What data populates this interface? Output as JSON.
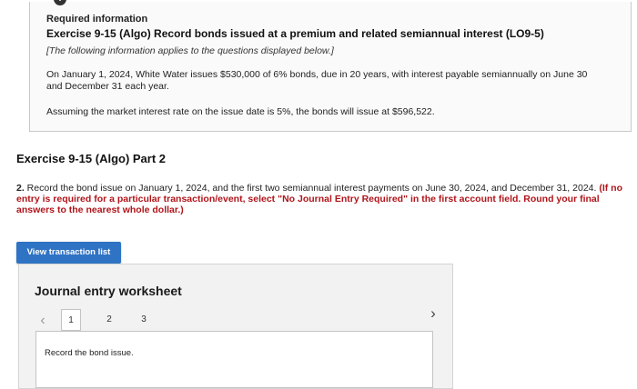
{
  "info": {
    "heading": "Required information",
    "title": "Exercise 9-15 (Algo) Record bonds issued at a premium and related semiannual interest (LO9-5)",
    "note": "[The following information applies to the questions displayed below.]",
    "para1": "On January 1, 2024, White Water issues $530,000 of 6% bonds, due in 20 years, with interest payable semiannually on June 30 and December 31 each year.",
    "para2": "Assuming the market interest rate on the issue date is 5%, the bonds will issue at $596,522."
  },
  "part": {
    "title": "Exercise 9-15 (Algo) Part 2"
  },
  "instructions": {
    "number": "2.",
    "text": " Record the bond issue on January 1, 2024, and the first two semiannual interest payments on June 30, 2024, and December 31, 2024. ",
    "emphasis": "(If no entry is required for a particular transaction/event, select \"No Journal Entry Required\" in the first account field. Round your final answers to the nearest whole dollar.)"
  },
  "buttons": {
    "view_transaction_list": "View transaction list"
  },
  "worksheet": {
    "title": "Journal entry worksheet",
    "pages": [
      "1",
      "2",
      "3"
    ],
    "active_page": "1",
    "prev_icon": "chevron-left-icon",
    "next_icon": "chevron-right-icon",
    "entry_prompt": "Record the bond issue."
  },
  "colors": {
    "button_blue": "#2f73c4",
    "emphasis_red": "#b0141a"
  }
}
